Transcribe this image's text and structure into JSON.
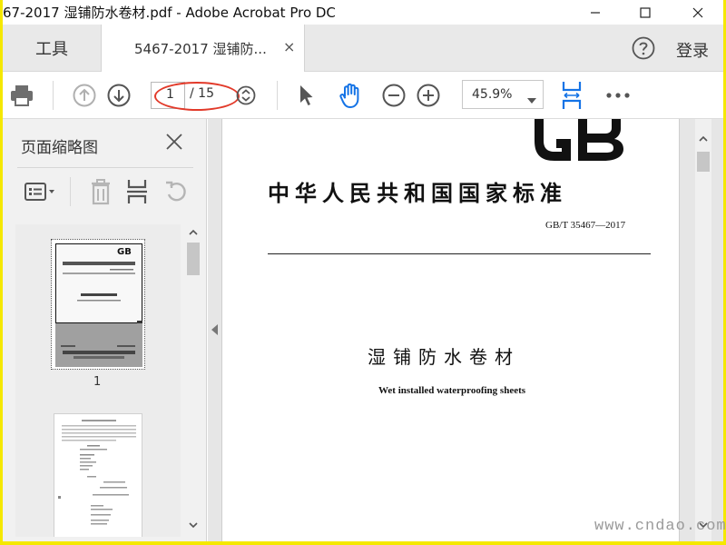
{
  "window": {
    "title": "67-2017 湿铺防水卷材.pdf - Adobe Acrobat Pro DC",
    "minimize_icon": "minimize-icon",
    "maximize_icon": "maximize-icon",
    "close_icon": "close-icon"
  },
  "tabs": {
    "tools_label": "工具",
    "document_tab_label": "5467-2017 湿铺防...",
    "document_tab_close": "×",
    "help_icon": "help-icon",
    "login_label": "登录"
  },
  "toolbar": {
    "print_icon": "print-icon",
    "prev_page_icon": "arrow-up-circle-icon",
    "next_page_icon": "arrow-down-circle-icon",
    "current_page": "1",
    "total_pages": "/ 15",
    "page_nav_icon": "page-nav-icon",
    "select_tool_icon": "cursor-arrow-icon",
    "hand_tool_icon": "hand-icon",
    "zoom_out_icon": "zoom-out-icon",
    "zoom_in_icon": "zoom-in-icon",
    "zoom_value": "45.9%",
    "fit_page_icon": "fit-page-icon",
    "more_icon": "more-icon"
  },
  "left_panel": {
    "title": "页面缩略图",
    "close_icon": "close-icon",
    "options_icon": "thumbnail-options-icon",
    "delete_icon": "trash-icon",
    "extract_icon": "extract-pages-icon",
    "rotate_icon": "rotate-icon",
    "thumbnails": [
      {
        "page_label": "1"
      },
      {
        "page_label": ""
      }
    ]
  },
  "document": {
    "logo_text": "GB",
    "standard_title": "中华人民共和国国家标准",
    "standard_code": "GB/T 35467—2017",
    "doc_title_cn": "湿铺防水卷材",
    "doc_title_en": "Wet installed waterproofing sheets"
  },
  "colors": {
    "accent_blue": "#1473e6",
    "annotation_red": "#e23a2a",
    "frame_yellow": "#f5e800",
    "icon_gray": "#6e6e6e"
  },
  "watermark": "www.cndao.com"
}
